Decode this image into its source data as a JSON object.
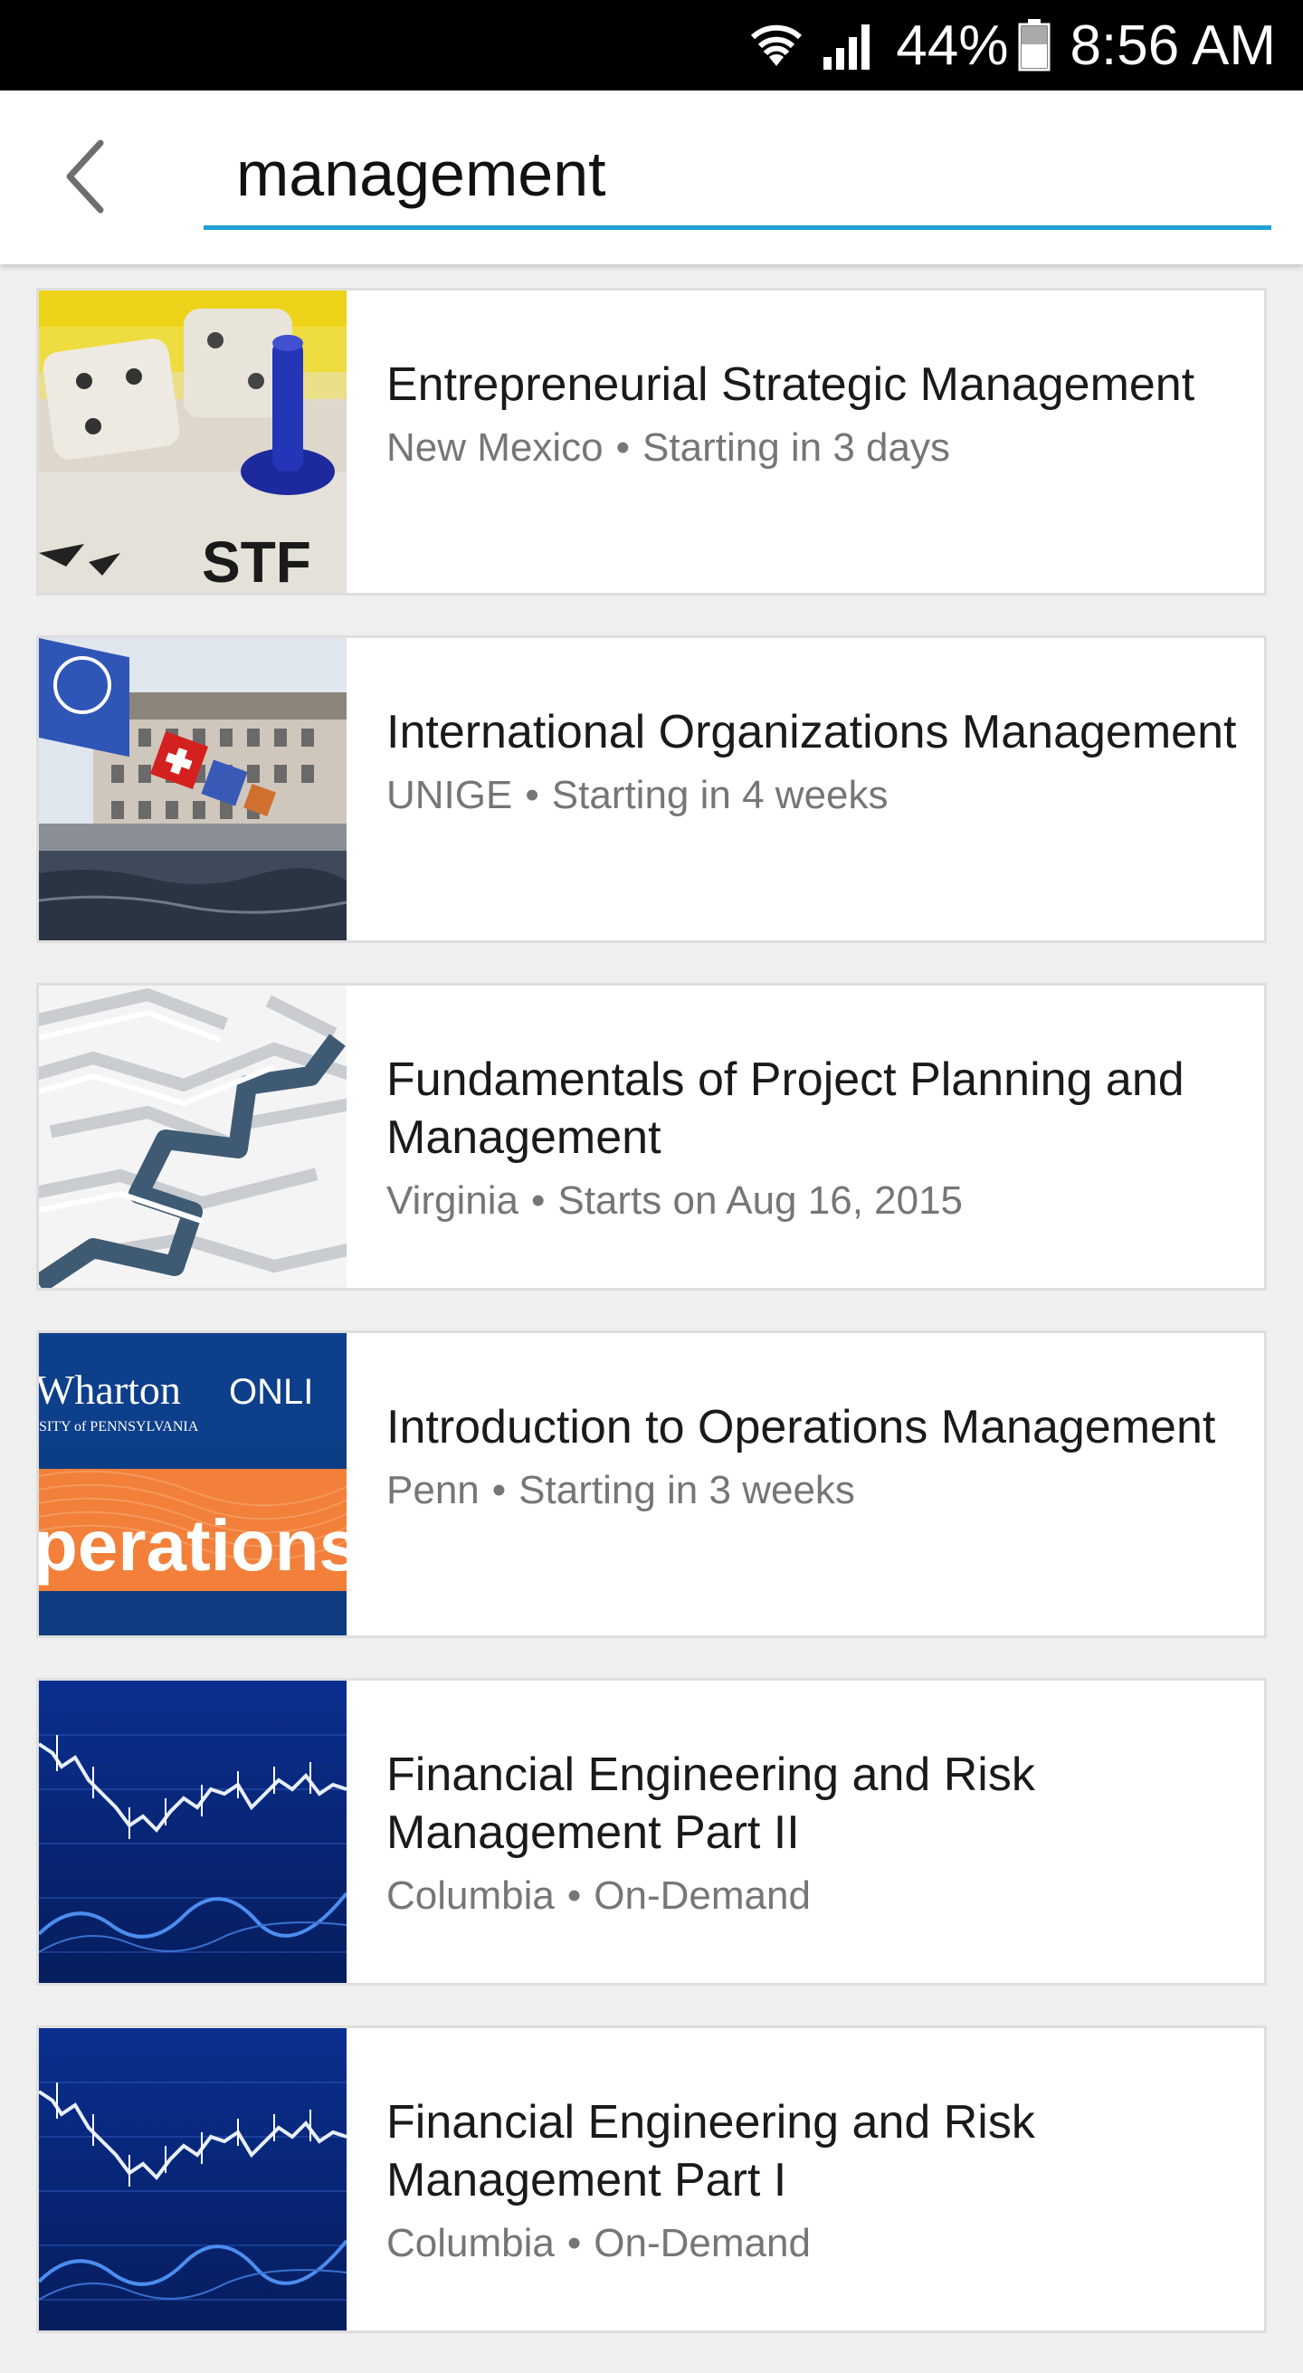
{
  "status_bar": {
    "battery": "44%",
    "time": "8:56 AM",
    "icons": [
      "wifi-icon",
      "signal-icon",
      "battery-icon"
    ]
  },
  "search": {
    "value": "management",
    "accent_color": "#1e9fd6"
  },
  "results": [
    {
      "title": "Entrepreneurial Strategic Management",
      "provider": "New Mexico",
      "schedule": "Starting in 3 days",
      "image": "dice-and-game-piece"
    },
    {
      "title": "International Organizations Management",
      "provider": "UNIGE",
      "schedule": "Starting in 4 weeks",
      "image": "geneva-bridge-flags"
    },
    {
      "title": "Fundamentals of Project Planning and Management",
      "provider": "Virginia",
      "schedule": "Starts on Aug 16, 2015",
      "image": "maze"
    },
    {
      "title": "Introduction to Operations Management",
      "provider": "Penn",
      "schedule": "Starting in 3 weeks",
      "image": "wharton-operations-banner",
      "image_text": {
        "brand": "Wharton",
        "online": "ONLI",
        "university": "SITY of PENNSYLVANIA",
        "word": "perations"
      }
    },
    {
      "title": "Financial Engineering and Risk Management Part II",
      "provider": "Columbia",
      "schedule": "On-Demand",
      "image": "stock-chart"
    },
    {
      "title": "Financial Engineering and Risk Management Part I",
      "provider": "Columbia",
      "schedule": "On-Demand",
      "image": "stock-chart"
    }
  ]
}
